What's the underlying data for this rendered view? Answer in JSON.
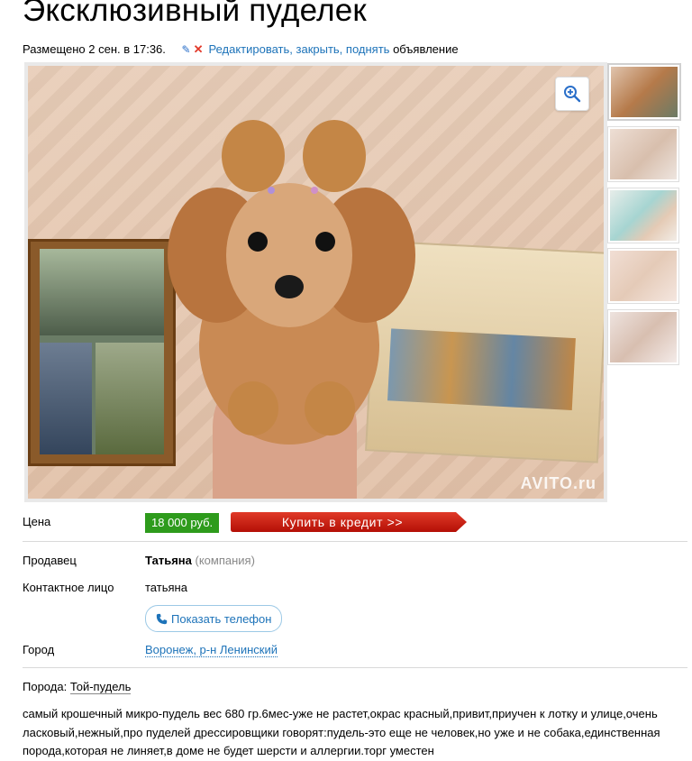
{
  "listing": {
    "title": "Эксклюзивный пуделек",
    "posted": "Размещено 2 сен. в 17:36.",
    "edit_link": "Редактировать, закрыть, поднять",
    "edit_suffix": "объявление"
  },
  "gallery": {
    "watermark": "AVITO.ru",
    "thumbnails": 5
  },
  "details": {
    "price_label": "Цена",
    "price_value": "18 000 руб.",
    "credit_button": "Купить в кредит >>",
    "seller_label": "Продавец",
    "seller_name": "Татьяна",
    "seller_type": "(компания)",
    "contact_label": "Контактное лицо",
    "contact_value": "татьяна",
    "phone_button": "Показать телефон",
    "city_label": "Город",
    "city_value": "Воронеж, р-н Ленинский"
  },
  "breed": {
    "label": "Порода:",
    "value": "Той-пудель"
  },
  "description": "самый крошечный микро-пудель вес 680 гр.6мес-уже не растет,окрас красный,привит,приучен к лотку и улице,очень ласковый,нежный,про пуделей дрессировщики говорят:пудель-это еще не человек,но уже и не собака,единственная порода,которая не линяет,в доме не будет шерсти и аллергии.торг уместен",
  "colors": {
    "link": "#1d73b9",
    "price_green": "#2e9b1c",
    "credit_red": "#c4140b"
  }
}
